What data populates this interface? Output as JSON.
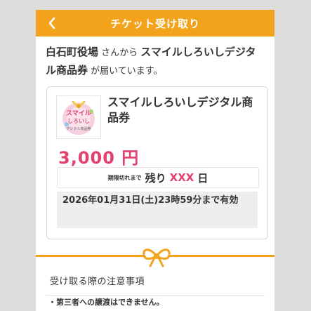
{
  "header": {
    "title": "チケット受け取り"
  },
  "intro": {
    "sender": "白石町役場",
    "from_text": " さんから ",
    "ticket_name": "スマイルしろいしデジタル商品券",
    "suffix": " が届いています。"
  },
  "ticket": {
    "title": "スマイルしろいしデジタル商品券",
    "logo_text_1": "スマイル",
    "logo_text_2": "しろいし",
    "logo_text_3": "デジタル商品券",
    "price": "3,000 円",
    "expiry_label": "期限切れまで",
    "remaining_prefix": "残り",
    "remaining_value": "XXX",
    "remaining_unit": "日",
    "deadline": "2026年01月31日(土)23時59分まで有効"
  },
  "notice": {
    "title": "受け取る際の注意事項",
    "items": [
      "・第三者への譲渡はできません。"
    ]
  },
  "colors": {
    "accent": "#f2a21b",
    "price": "#e2406e"
  }
}
